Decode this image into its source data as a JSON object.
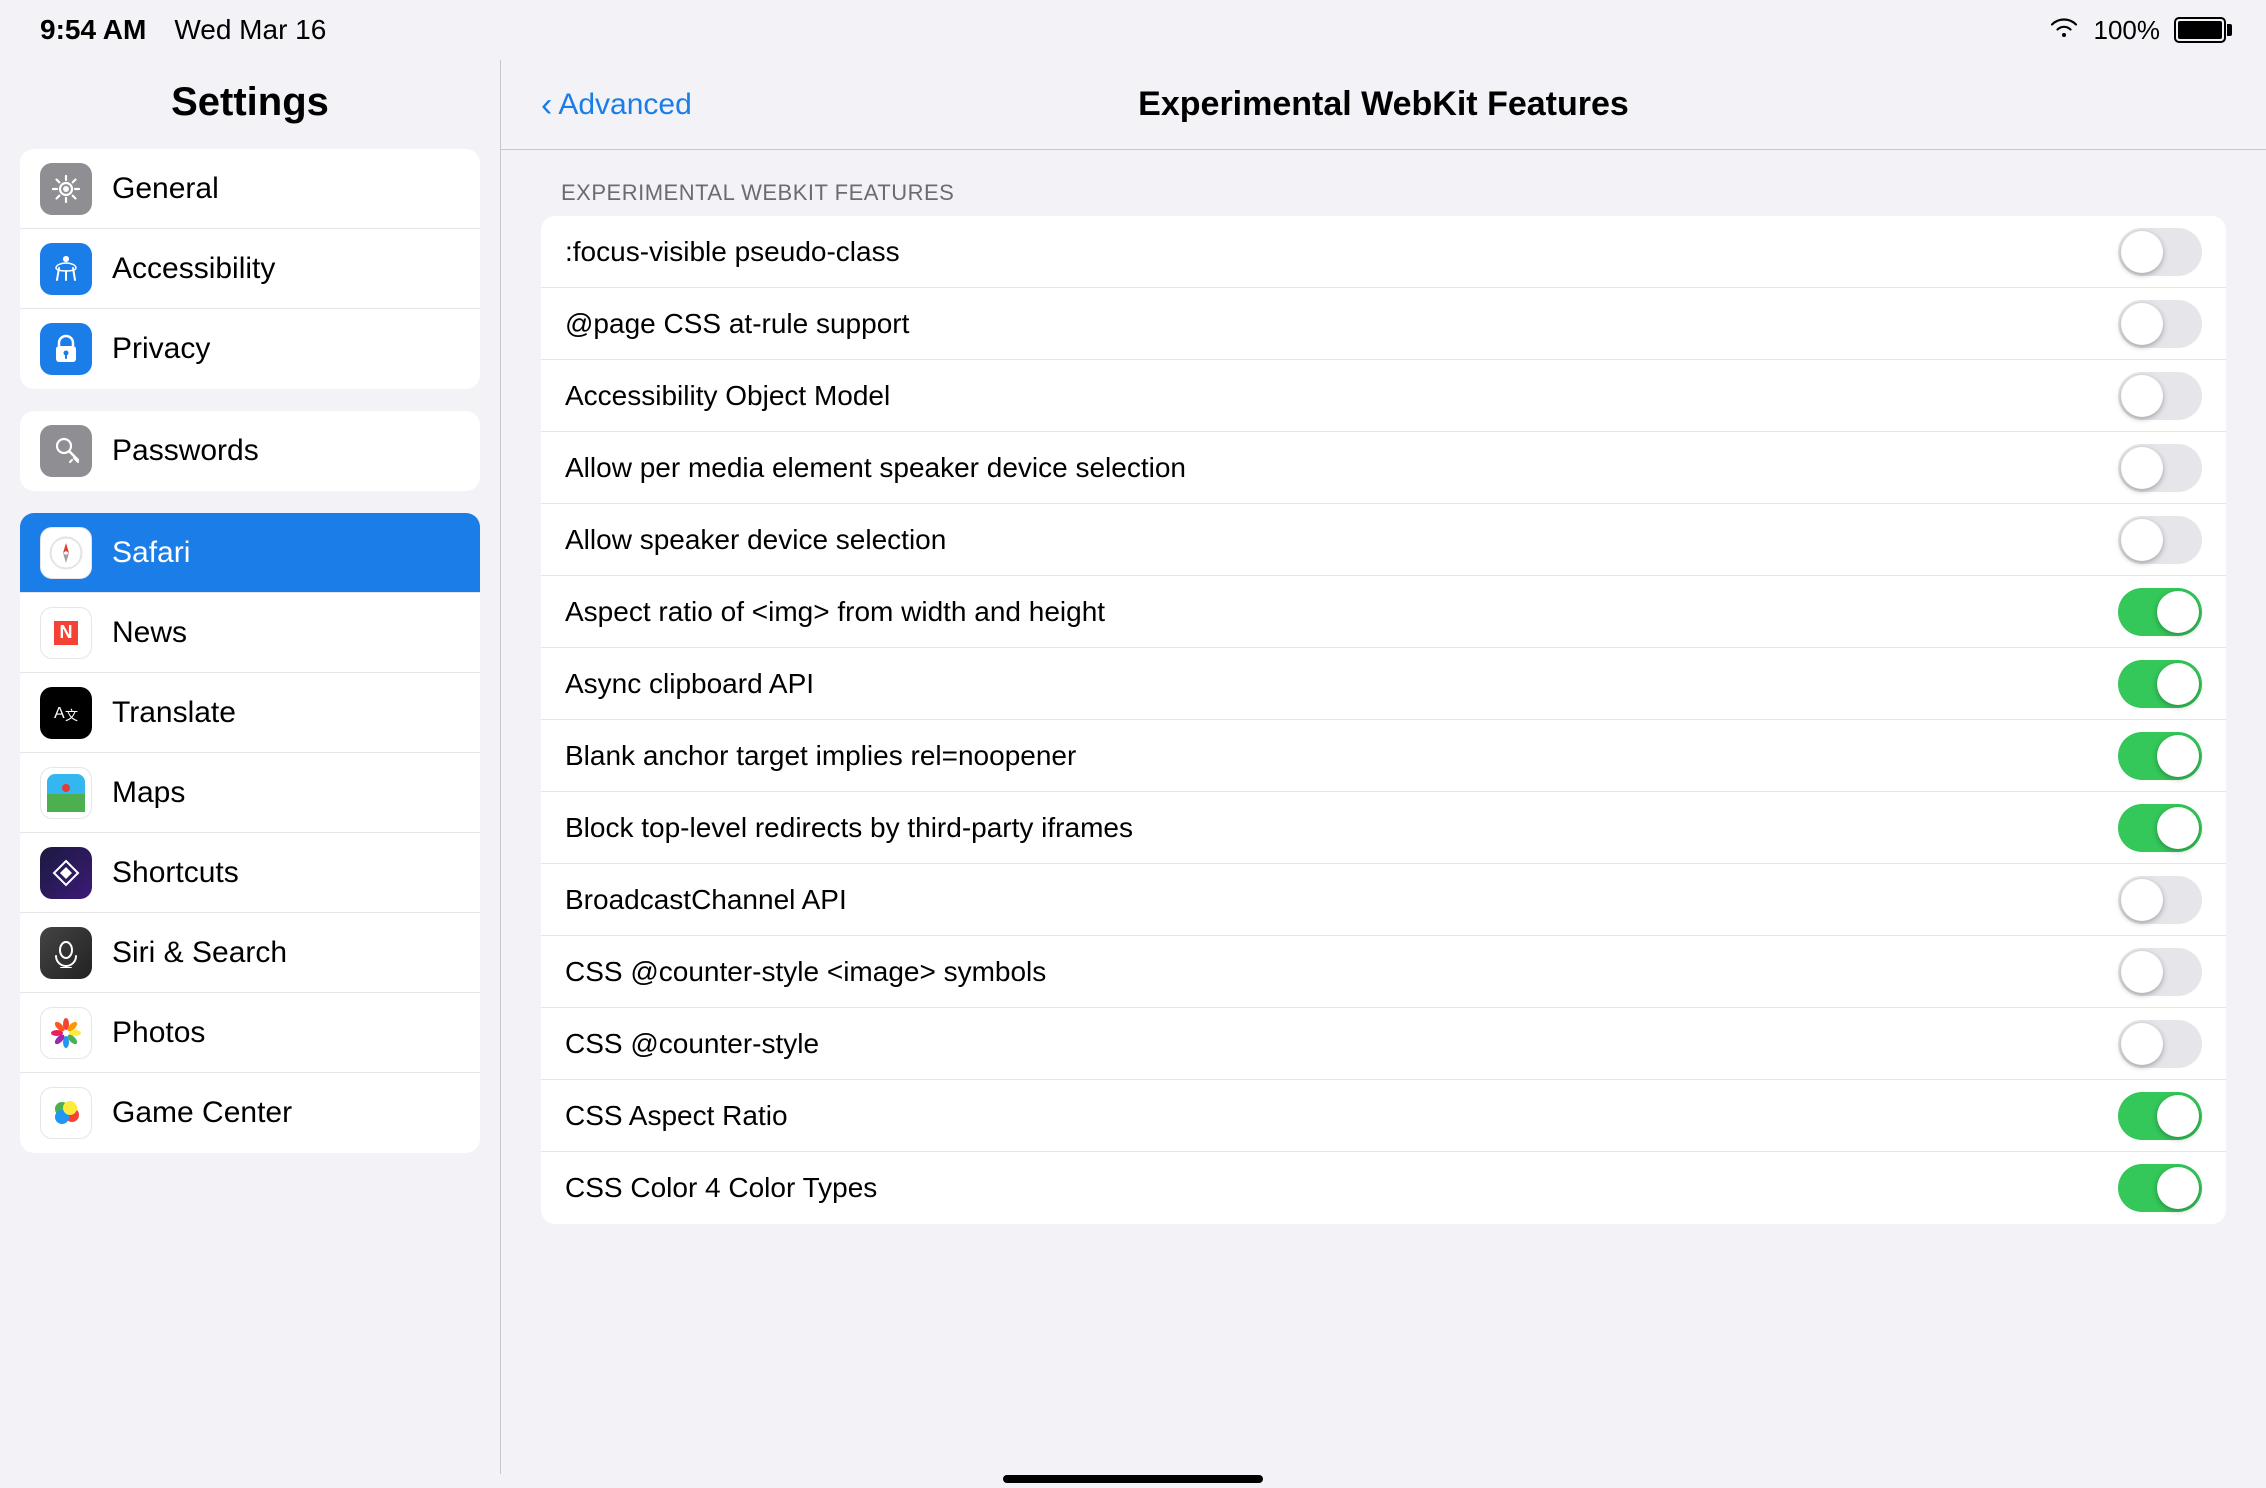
{
  "statusBar": {
    "time": "9:54 AM",
    "date": "Wed Mar 16",
    "battery": "100%"
  },
  "leftPanel": {
    "title": "Settings",
    "groups": [
      {
        "items": [
          {
            "id": "general",
            "label": "General",
            "iconBg": "#8e8e93",
            "iconColor": "#fff",
            "iconSymbol": "⚙️"
          },
          {
            "id": "accessibility",
            "label": "Accessibility",
            "iconBg": "#1a7de8",
            "iconColor": "#fff",
            "iconSymbol": "♿"
          },
          {
            "id": "privacy",
            "label": "Privacy",
            "iconBg": "#1a7de8",
            "iconColor": "#fff",
            "iconSymbol": "✋"
          }
        ]
      },
      {
        "items": [
          {
            "id": "passwords",
            "label": "Passwords",
            "iconBg": "#8e8e93",
            "iconColor": "#fff",
            "iconSymbol": "🔑"
          }
        ]
      },
      {
        "items": [
          {
            "id": "safari",
            "label": "Safari",
            "iconBg": "#1a7de8",
            "iconColor": "#fff",
            "iconSymbol": "🧭",
            "active": true
          },
          {
            "id": "news",
            "label": "News",
            "iconBg": "#fff",
            "iconColor": "#fff",
            "iconSymbol": "📰"
          },
          {
            "id": "translate",
            "label": "Translate",
            "iconBg": "#000",
            "iconColor": "#fff",
            "iconSymbol": "🔤"
          },
          {
            "id": "maps",
            "label": "Maps",
            "iconBg": "#fff",
            "iconColor": "#fff",
            "iconSymbol": "🗺️"
          },
          {
            "id": "shortcuts",
            "label": "Shortcuts",
            "iconBg": "#1a1a2e",
            "iconColor": "#fff",
            "iconSymbol": "⬡"
          },
          {
            "id": "siri",
            "label": "Siri & Search",
            "iconBg": "#000",
            "iconColor": "#fff",
            "iconSymbol": "🎙️"
          },
          {
            "id": "photos",
            "label": "Photos",
            "iconBg": "#fff",
            "iconColor": "#fff",
            "iconSymbol": "🌸"
          },
          {
            "id": "gamecenter",
            "label": "Game Center",
            "iconBg": "#fff",
            "iconColor": "#fff",
            "iconSymbol": "🎮"
          }
        ]
      }
    ]
  },
  "rightPanel": {
    "backLabel": "Advanced",
    "title": "Experimental WebKit Features",
    "sectionHeader": "EXPERIMENTAL WEBKIT FEATURES",
    "features": [
      {
        "label": ":focus-visible pseudo-class",
        "on": false
      },
      {
        "label": "@page CSS at-rule support",
        "on": false
      },
      {
        "label": "Accessibility Object Model",
        "on": false
      },
      {
        "label": "Allow per media element speaker device selection",
        "on": false
      },
      {
        "label": "Allow speaker device selection",
        "on": false
      },
      {
        "label": "Aspect ratio of <img> from width and height",
        "on": true
      },
      {
        "label": "Async clipboard API",
        "on": true
      },
      {
        "label": "Blank anchor target implies rel=noopener",
        "on": true
      },
      {
        "label": "Block top-level redirects by third-party iframes",
        "on": true
      },
      {
        "label": "BroadcastChannel API",
        "on": false
      },
      {
        "label": "CSS @counter-style <image> symbols",
        "on": false
      },
      {
        "label": "CSS @counter-style",
        "on": false
      },
      {
        "label": "CSS Aspect Ratio",
        "on": true
      },
      {
        "label": "CSS Color 4 Color Types",
        "on": true
      }
    ]
  }
}
